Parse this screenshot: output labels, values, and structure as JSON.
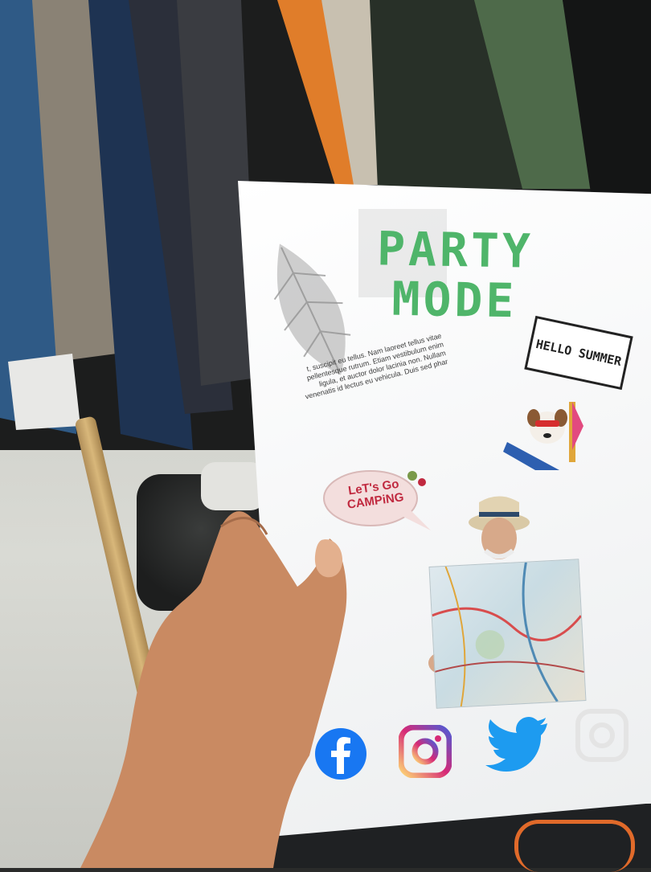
{
  "poster": {
    "title_line1": "PARTY",
    "title_line2": "MODE",
    "body_text": "t, suscipit eu tellus. Nam laoreet tellus vitae pellentesque rutrum. Etiam vestibulum enim ligula, et auctor dolor lacinia non. Nullam venenatis id lectus eu vehicula. Duis sed phar",
    "sticker_hello": "HELLO SUMMER",
    "camping_bubble": "LeT's Go CAMPiNG",
    "colors": {
      "title_green": "#4fb56a",
      "camping_red": "#c0293f",
      "facebook_blue": "#1877f2",
      "twitter_blue": "#1d9bf0",
      "instagram_gradient": "#d62976"
    }
  },
  "social_icons": [
    "facebook-icon",
    "instagram-icon",
    "twitter-icon",
    "instagram-faded-icon"
  ]
}
